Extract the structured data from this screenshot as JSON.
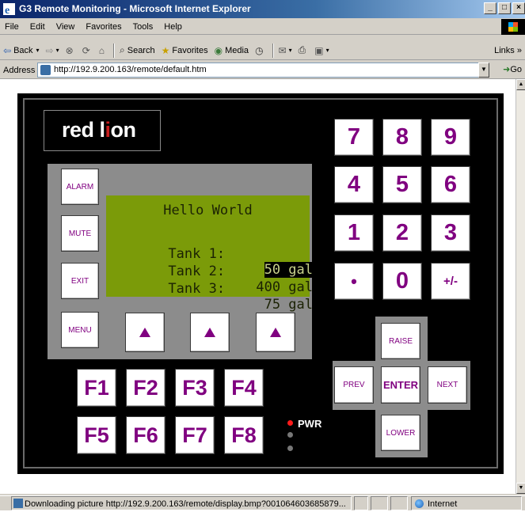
{
  "browser": {
    "title": "G3 Remote Monitoring - Microsoft Internet Explorer",
    "window_controls": [
      "_",
      "□",
      "×"
    ],
    "menu": [
      "File",
      "Edit",
      "View",
      "Favorites",
      "Tools",
      "Help"
    ],
    "toolbar": {
      "back": "Back",
      "search": "Search",
      "favorites": "Favorites",
      "media": "Media",
      "links": "Links"
    },
    "address_label": "Address",
    "address_url": "http://192.9.200.163/remote/default.htm",
    "go": "Go",
    "status_text": "Downloading picture http://192.9.200.163/remote/display.bmp?001064603685879...",
    "zone": "Internet"
  },
  "device": {
    "logo_pre": "red l",
    "logo_i": "i",
    "logo_post": "on",
    "side_buttons": [
      "ALARM",
      "MUTE",
      "EXIT",
      "MENU"
    ],
    "lcd": {
      "title": "Hello World",
      "rows": [
        {
          "label": "Tank 1:",
          "value": "50 gal",
          "highlighted": true
        },
        {
          "label": "Tank 2:",
          "value": "400 gal",
          "highlighted": false
        },
        {
          "label": "Tank 3:",
          "value": "75 gal",
          "highlighted": false
        }
      ]
    },
    "soft_keys": [
      "up-arrow-icon",
      "up-arrow-icon",
      "up-arrow-icon"
    ],
    "function_keys": [
      "F1",
      "F2",
      "F3",
      "F4",
      "F5",
      "F6",
      "F7",
      "F8"
    ],
    "keypad": [
      "7",
      "8",
      "9",
      "4",
      "5",
      "6",
      "1",
      "2",
      "3",
      "•",
      "0",
      "+/-"
    ],
    "nav": {
      "raise": "RAISE",
      "prev": "PREV",
      "enter": "ENTER",
      "next": "NEXT",
      "lower": "LOWER"
    },
    "pwr_label": "PWR",
    "colors": {
      "key_text": "#800080",
      "lcd_bg": "#7b9b09",
      "bezel": "#8c8c8c",
      "pwr_led": "#ff0000"
    }
  }
}
